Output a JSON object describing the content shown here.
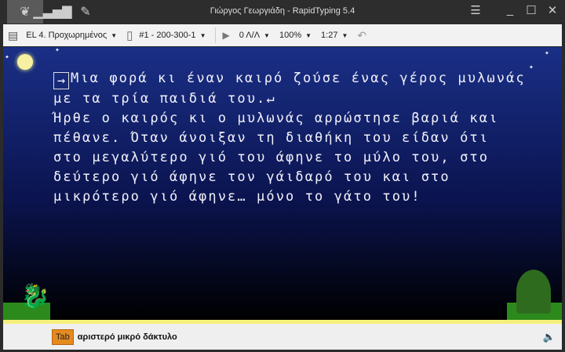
{
  "window": {
    "title": "Γιώργος Γεωργιάδη - RapidTyping 5.4"
  },
  "toolbar": {
    "course": "EL 4. Προχωρημένος",
    "lesson": "#1 - 200-300-1",
    "speed": "0 Λ/Λ",
    "zoom": "100%",
    "time": "1:27"
  },
  "lesson_text": {
    "lines": [
      "Μια φορά κι έναν καιρό ζούσε ένας γέρος μυλωνάς",
      "με τα τρία παιδιά του.",
      "Ήρθε ο καιρός κι ο μυλωνάς αρρώστησε βαριά και",
      "πέθανε. Όταν άνοιξαν τη διαθήκη του είδαν ότι",
      "στο μεγαλύτερο γιό του άφηνε το μύλο του, στο",
      "δεύτερο γιό άφηνε τον γάιδαρό του και στο",
      "μικρότερο γιό άφηνε… μόνο το γάτο του!"
    ],
    "tab_symbol": "→",
    "enter_symbol": "↵"
  },
  "status": {
    "key": "Tab",
    "finger": "αριστερό μικρό δάκτυλο"
  }
}
